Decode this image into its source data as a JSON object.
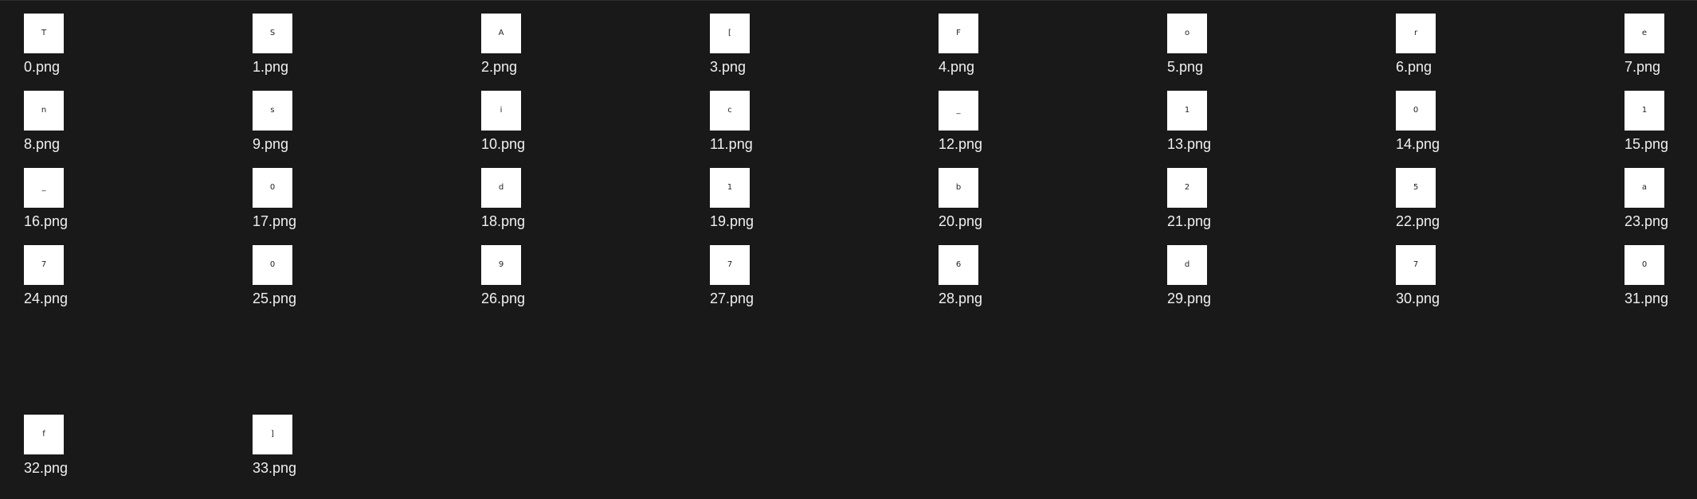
{
  "files": [
    {
      "name": "0.png",
      "glyph": "T"
    },
    {
      "name": "1.png",
      "glyph": "S"
    },
    {
      "name": "2.png",
      "glyph": "A"
    },
    {
      "name": "3.png",
      "glyph": "["
    },
    {
      "name": "4.png",
      "glyph": "F"
    },
    {
      "name": "5.png",
      "glyph": "o"
    },
    {
      "name": "6.png",
      "glyph": "r"
    },
    {
      "name": "7.png",
      "glyph": "e"
    },
    {
      "name": "8.png",
      "glyph": "n"
    },
    {
      "name": "9.png",
      "glyph": "s"
    },
    {
      "name": "10.png",
      "glyph": "i"
    },
    {
      "name": "11.png",
      "glyph": "c"
    },
    {
      "name": "12.png",
      "glyph": "_"
    },
    {
      "name": "13.png",
      "glyph": "1"
    },
    {
      "name": "14.png",
      "glyph": "0"
    },
    {
      "name": "15.png",
      "glyph": "1"
    },
    {
      "name": "16.png",
      "glyph": "_"
    },
    {
      "name": "17.png",
      "glyph": "0"
    },
    {
      "name": "18.png",
      "glyph": "d"
    },
    {
      "name": "19.png",
      "glyph": "1"
    },
    {
      "name": "20.png",
      "glyph": "b"
    },
    {
      "name": "21.png",
      "glyph": "2"
    },
    {
      "name": "22.png",
      "glyph": "5"
    },
    {
      "name": "23.png",
      "glyph": "a"
    },
    {
      "name": "24.png",
      "glyph": "7"
    },
    {
      "name": "25.png",
      "glyph": "0"
    },
    {
      "name": "26.png",
      "glyph": "9"
    },
    {
      "name": "27.png",
      "glyph": "7"
    },
    {
      "name": "28.png",
      "glyph": "6"
    },
    {
      "name": "29.png",
      "glyph": "d"
    },
    {
      "name": "30.png",
      "glyph": "7"
    },
    {
      "name": "31.png",
      "glyph": "0"
    },
    {
      "name": "32.png",
      "glyph": "f"
    },
    {
      "name": "33.png",
      "glyph": "]"
    }
  ],
  "colors": {
    "background": "#191919",
    "thumbnail": "#ffffff",
    "label": "#f0f0f0"
  }
}
